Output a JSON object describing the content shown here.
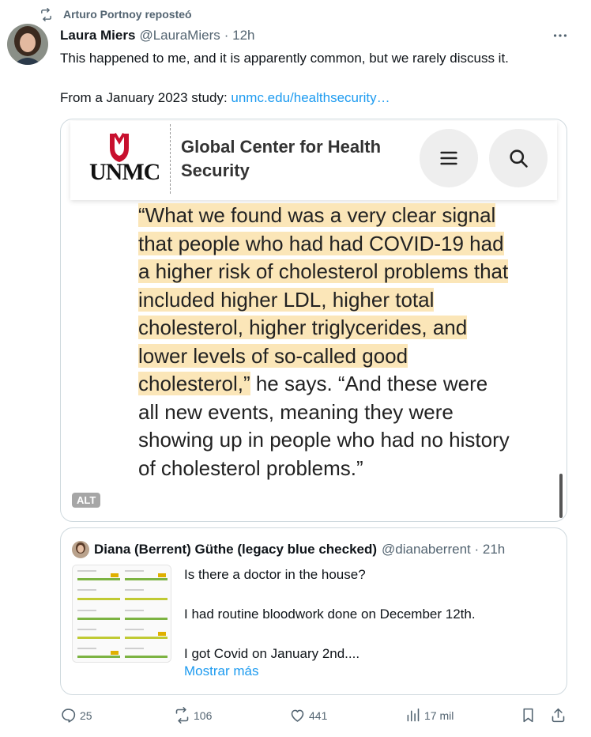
{
  "repost": {
    "text": "Arturo Portnoy reposteó"
  },
  "tweet": {
    "name": "Laura Miers",
    "handle": "@LauraMiers",
    "time": "· 12h",
    "text_line1": "This happened to me, and it is apparently common, but we rarely discuss it.",
    "text_line2_prefix": "From a January 2023 study: ",
    "link": "unmc.edu/healthsecurity…"
  },
  "media": {
    "logo_text": "UNMC",
    "title_line1": "Global Center for Health",
    "title_line2": "Security",
    "highlighted_quote": "“What we found was a very clear signal that people who had had COVID-19 had a higher risk of cholesterol problems that included higher LDL, higher total cholesterol, higher triglycerides, and lower levels of so-called good cholesterol,”",
    "quote_rest": " he says. “And these were all new events, meaning they were showing up in people who had no history of cholesterol problems.”",
    "alt_badge": "ALT"
  },
  "quoted_tweet": {
    "name": "Diana (Berrent) Güthe (legacy blue checked)",
    "handle": "@dianaberrent · 21h",
    "line1": "Is there a doctor in the house?",
    "line2": "I had routine bloodwork done on December 12th.",
    "line3": "I got Covid on January 2nd....",
    "show_more": "Mostrar más"
  },
  "actions": {
    "replies": "25",
    "reposts": "106",
    "likes": "441",
    "views": "17 mil"
  },
  "colors": {
    "accent": "#1d9bf0",
    "muted": "#536471",
    "highlight": "#fbe6b8",
    "unmc_red": "#c8102e"
  },
  "icons": [
    "repost-icon",
    "more-icon",
    "menu-icon",
    "search-icon",
    "reply-icon",
    "like-icon",
    "views-icon",
    "bookmark-icon",
    "share-icon"
  ]
}
